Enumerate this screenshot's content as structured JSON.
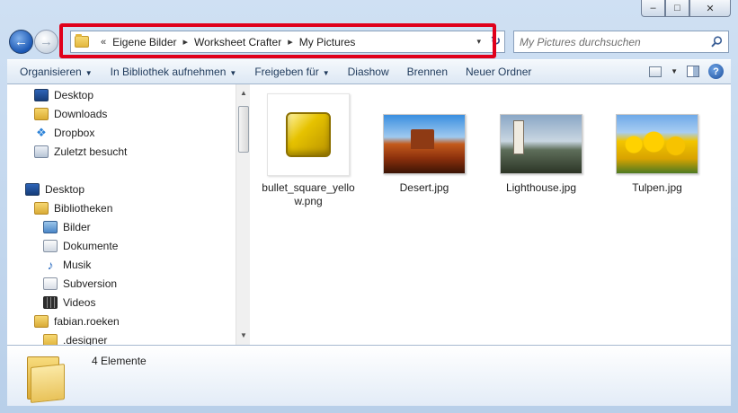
{
  "window": {
    "controls": {
      "minimize": "–",
      "maximize": "□",
      "close": "✕"
    }
  },
  "navigation": {
    "back_icon": "←",
    "forward_icon": "→",
    "dropdown_icon": "▾"
  },
  "address": {
    "overflow": "«",
    "separator": "▸",
    "crumbs": [
      "Eigene Bilder",
      "Worksheet Crafter",
      "My Pictures"
    ],
    "dropdown_icon": "▾",
    "refresh_icon": "↻"
  },
  "search": {
    "placeholder": "My Pictures durchsuchen"
  },
  "toolbar": {
    "organize": "Organisieren",
    "add_library": "In Bibliothek aufnehmen",
    "share": "Freigeben für",
    "slideshow": "Diashow",
    "burn": "Brennen",
    "new_folder": "Neuer Ordner",
    "caret": "▼",
    "help": "?"
  },
  "nav_pane": {
    "items": [
      {
        "label": "Desktop",
        "icon": "desktop-icon"
      },
      {
        "label": "Downloads",
        "icon": "downloads-folder-icon"
      },
      {
        "label": "Dropbox",
        "icon": "dropbox-icon"
      },
      {
        "label": "Zuletzt besucht",
        "icon": "recent-places-icon"
      },
      {
        "label": "Desktop",
        "icon": "desktop-icon"
      },
      {
        "label": "Bibliotheken",
        "icon": "library-icon"
      },
      {
        "label": "Bilder",
        "icon": "pictures-icon"
      },
      {
        "label": "Dokumente",
        "icon": "documents-icon"
      },
      {
        "label": "Musik",
        "icon": "music-icon"
      },
      {
        "label": "Subversion",
        "icon": "subversion-icon"
      },
      {
        "label": "Videos",
        "icon": "videos-icon"
      },
      {
        "label": "fabian.roeken",
        "icon": "user-folder-icon"
      },
      {
        "label": ".designer",
        "icon": "folder-icon"
      }
    ],
    "scroll_up": "▲",
    "scroll_down": "▼"
  },
  "files": [
    {
      "name": "bullet_square_yellow.png",
      "type": "png"
    },
    {
      "name": "Desert.jpg",
      "type": "jpg"
    },
    {
      "name": "Lighthouse.jpg",
      "type": "jpg"
    },
    {
      "name": "Tulpen.jpg",
      "type": "jpg"
    }
  ],
  "details": {
    "count": "4 Elemente"
  },
  "colors": {
    "highlight": "#e0001b",
    "toolbar_text": "#1e395b"
  }
}
